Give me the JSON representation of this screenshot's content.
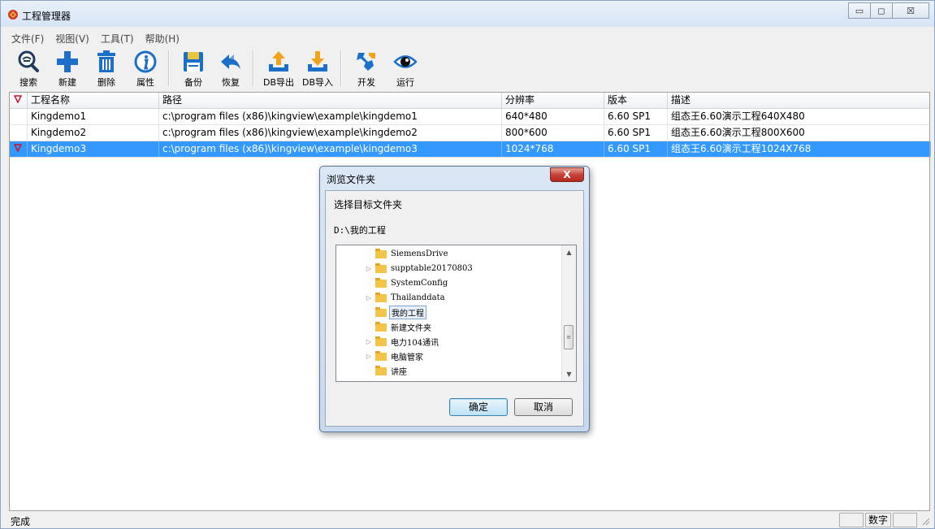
{
  "window": {
    "title": "工程管理器",
    "controls": {
      "minimize": "▭",
      "maximize": "◻",
      "close": "☒"
    }
  },
  "menu": [
    "文件(F)",
    "视图(V)",
    "工具(T)",
    "帮助(H)"
  ],
  "toolbar": {
    "search": "搜索",
    "new": "新建",
    "delete": "删除",
    "properties": "属性",
    "backup": "备份",
    "restore": "恢复",
    "db_export": "DB导出",
    "db_import": "DB导入",
    "develop": "开发",
    "run": "运行"
  },
  "table": {
    "headers": [
      "工程名称",
      "路径",
      "分辨率",
      "版本",
      "描述"
    ],
    "rows": [
      [
        "Kingdemo1",
        "c:\\program files (x86)\\kingview\\example\\kingdemo1",
        "640*480",
        "6.60 SP1",
        "组态王6.60演示工程640X480"
      ],
      [
        "Kingdemo2",
        "c:\\program files (x86)\\kingview\\example\\kingdemo2",
        "800*600",
        "6.60 SP1",
        "组态王6.60演示工程800X600"
      ],
      [
        "Kingdemo3",
        "c:\\program files (x86)\\kingview\\example\\kingdemo3",
        "1024*768",
        "6.60 SP1",
        "组态王6.60演示工程1024X768"
      ]
    ],
    "selected_row": 2
  },
  "status": {
    "text": "完成",
    "num_indicator": "数字"
  },
  "dialog": {
    "title": "浏览文件夹",
    "close": "X",
    "prompt": "选择目标文件夹",
    "path": "D:\\我的工程",
    "folders": [
      {
        "name": "SiemensDrive",
        "expandable": false
      },
      {
        "name": "supptable20170803",
        "expandable": true
      },
      {
        "name": "SystemConfig",
        "expandable": false
      },
      {
        "name": "Thailanddata",
        "expandable": true
      },
      {
        "name": "我的工程",
        "expandable": false,
        "selected": true
      },
      {
        "name": "新建文件夹",
        "expandable": false
      },
      {
        "name": "电力104通讯",
        "expandable": true
      },
      {
        "name": "电脑管家",
        "expandable": true
      },
      {
        "name": "讲座",
        "expandable": false
      }
    ],
    "ok": "确定",
    "cancel": "取消"
  },
  "colors": {
    "selection": "#3399ff",
    "flag": "#d0102a",
    "accent_blue": "#1b6fc8",
    "folder": "#f2c44a"
  }
}
